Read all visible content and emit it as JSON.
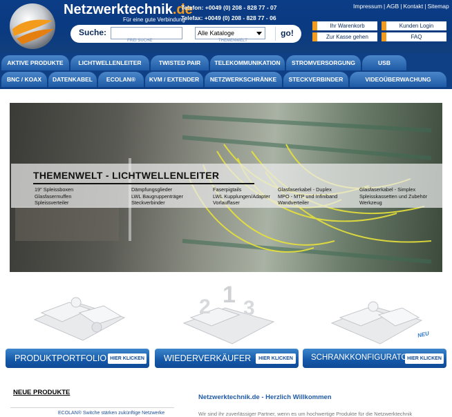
{
  "header": {
    "brand_main": "Netzwerktechnik",
    "brand_tld": ".de",
    "tagline": "Für eine gute Verbindung",
    "phone": "Telefon: +0049 (0) 208 - 828 77 - 07",
    "fax": "Telefax: +0049 (0) 208 - 828 77 - 06",
    "toplinks": [
      "Impressum",
      "AGB",
      "Kontakt",
      "Sitemap"
    ]
  },
  "search": {
    "label": "Suche:",
    "input_value": "",
    "free_label": "FREI SUCHE",
    "catalog_value": "Alle Kataloge",
    "themen_label": "THEMENWELT",
    "go_label": "go!"
  },
  "quick": {
    "warenkorb": "Ihr Warenkorb",
    "kasse": "Zur Kasse gehen",
    "login": "Kunden Login",
    "faq": "FAQ"
  },
  "nav": {
    "row1": [
      "AKTIVE PRODUKTE",
      "LICHTWELLENLEITER",
      "TWISTED PAIR",
      "TELEKOMMUNIKATION",
      "STROMVERSORGUNG",
      "USB"
    ],
    "row2": [
      "BNC / KOAX",
      "DATENKABEL",
      "ECOLAN®",
      "KVM / EXTENDER",
      "NETZWERKSCHRÄNKE",
      "STECKVERBINDER",
      "VIDEOÜBERWACHUNG"
    ]
  },
  "banner": {
    "title": "THEMENWELT  - LICHTWELLENLEITER",
    "columns": [
      [
        "19\" Spleissboxen",
        "Glasfasermuffen",
        "Spleissverteiler"
      ],
      [
        "Dämpfungsglieder",
        "LWL  Baugruppenträger",
        "Steckverbinder"
      ],
      [
        "Faserpigtails",
        "LWL Kupplungen/Adapter",
        "Vorlauffaser"
      ],
      [
        "Glasfaserkabel - Duplex",
        "MPO - MTP und Infiniband",
        "Wandverteiler"
      ],
      [
        "Glasfaserkabel - Simplex",
        "Spleisskassetten und Zubehör",
        "Werkzeug"
      ]
    ]
  },
  "promo": {
    "items": [
      {
        "label": "PRODUKTPORTFOLIO",
        "cta": "HIER KLICKEN"
      },
      {
        "label": "WIEDERVERKÄUFER",
        "cta": "HIER KLICKEN"
      },
      {
        "label": "SCHRANKKONFIGURATOR",
        "cta": "HIER KLICKEN"
      }
    ],
    "neu": "NEU"
  },
  "bottom": {
    "neue_produkte": "NEUE PRODUKTE",
    "news_text": "ECOLAN® Switche stärken zukünftige Netzwerke",
    "welcome_title": "Netzwerktechnik.de - Herzlich Willkommen",
    "welcome_text": "Wir sind ihr zuverlässiger Partner, wenn es um hochwertige Produkte für die Netzwerktechnik"
  },
  "colors": {
    "header_blue": "#0b3c86",
    "accent_orange": "#f39b1c",
    "tab_blue": "#2f6db5"
  }
}
